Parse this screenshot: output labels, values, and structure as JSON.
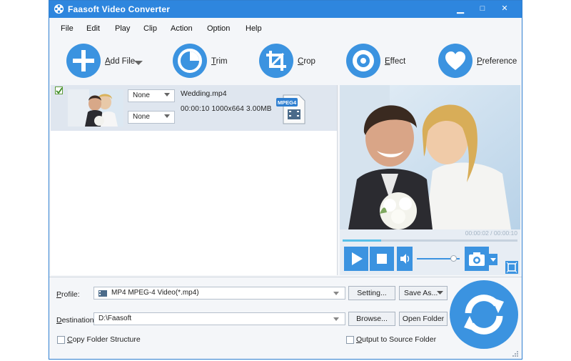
{
  "app": {
    "title": "Faasoft Video Converter"
  },
  "window_controls": {
    "minimize": "▁",
    "maximize": "□",
    "close": "✕"
  },
  "menu": [
    "File",
    "Edit",
    "Play",
    "Clip",
    "Action",
    "Option",
    "Help"
  ],
  "toolbar": {
    "add_file": {
      "label_u": "A",
      "label_rest": "dd File",
      "icon": "plus-icon"
    },
    "trim": {
      "label_u": "T",
      "label_rest": "rim",
      "icon": "pie-icon"
    },
    "crop": {
      "label_u": "C",
      "label_rest": "rop",
      "icon": "crop-icon"
    },
    "effect": {
      "label_u": "E",
      "label_rest": "ffect",
      "icon": "target-icon"
    },
    "preference": {
      "label_u": "P",
      "label_rest": "reference",
      "icon": "heart-icon"
    }
  },
  "file_list": [
    {
      "checked": true,
      "audio_track": "None",
      "subtitle": "None",
      "name": "Wedding.mp4",
      "info": "00:00:10   1000x664  3.00MB",
      "format_badge": "MPEG4"
    }
  ],
  "preview": {
    "timecode": "00:00:02 / 00:00:10",
    "progress": 0.22,
    "volume": 0.85
  },
  "bottom": {
    "profile_label_u": "P",
    "profile_label_rest": "rofile:",
    "profile_value": "MP4 MPEG-4 Video(*.mp4)",
    "setting_button": "Setting...",
    "save_as_button": "Save As...",
    "destination_label_u": "D",
    "destination_label_rest": "estination:",
    "destination_value": "D:\\Faasoft",
    "browse_button": "Browse...",
    "open_folder_button": "Open Folder",
    "copy_folder_u": "C",
    "copy_folder_rest": "opy Folder Structure",
    "output_source_u": "O",
    "output_source_rest": "utput to Source Folder"
  },
  "colors": {
    "titlebar": "#2e86de",
    "accent": "#3b93e0",
    "seek": "#59c0e8"
  }
}
